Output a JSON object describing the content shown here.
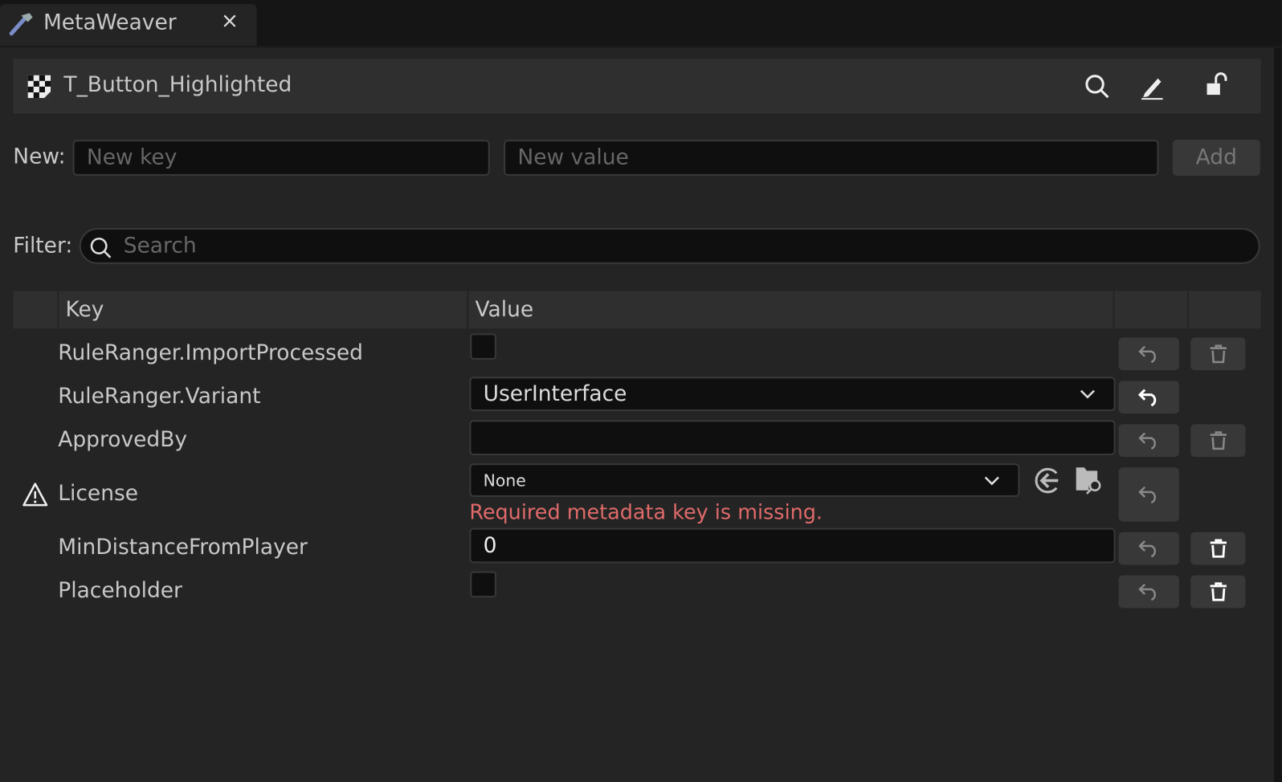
{
  "tab": {
    "title": "MetaWeaver",
    "close": "×"
  },
  "header": {
    "asset_name": "T_Button_Highlighted"
  },
  "new_row": {
    "label": "New:",
    "key_placeholder": "New key",
    "value_placeholder": "New value",
    "add_label": "Add"
  },
  "filter": {
    "label": "Filter:",
    "placeholder": "Search"
  },
  "table": {
    "columns": [
      "Key",
      "Value"
    ],
    "rows": [
      {
        "key": "RuleRanger.ImportProcessed",
        "type": "checkbox",
        "checked": false
      },
      {
        "key": "RuleRanger.Variant",
        "type": "dropdown",
        "value": "UserInterface"
      },
      {
        "key": "ApprovedBy",
        "type": "text",
        "value": ""
      },
      {
        "key": "License",
        "type": "asset",
        "value": "None",
        "error": "Required metadata key is missing.",
        "warning": true
      },
      {
        "key": "MinDistanceFromPlayer",
        "type": "number",
        "value": "0"
      },
      {
        "key": "Placeholder",
        "type": "checkbox",
        "checked": false
      }
    ]
  },
  "colors": {
    "error": "#e06a6a",
    "panel": "#242424",
    "input": "#0f0f0f",
    "button": "#383838"
  }
}
